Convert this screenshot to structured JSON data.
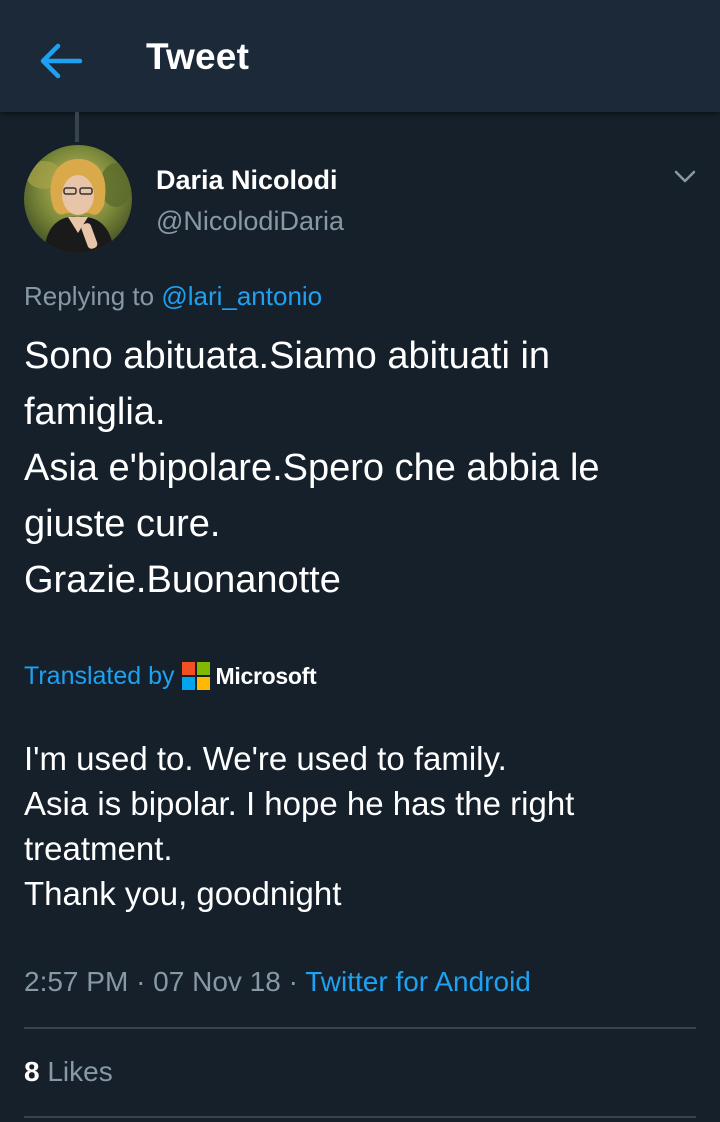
{
  "header": {
    "title": "Tweet",
    "back_icon": "arrow-left-icon"
  },
  "author": {
    "name": "Daria Nicolodi",
    "handle": "@NicolodiDaria",
    "avatar_icon": "profile-photo"
  },
  "reply": {
    "prefix": "Replying to",
    "mention": "@lari_antonio"
  },
  "tweet": {
    "lines": [
      "Sono abituata.Siamo abituati in",
      "famiglia.",
      "Asia e'bipolare.Spero che abbia le",
      "giuste cure.",
      "Grazie.Buonanotte"
    ]
  },
  "translation": {
    "label": "Translated by",
    "provider": "Microsoft",
    "lines": [
      "I'm used to. We're used to family.",
      "Asia is bipolar. I hope he has the right",
      "treatment.",
      "Thank you, goodnight"
    ]
  },
  "meta": {
    "time": "2:57 PM",
    "separator": "·",
    "date": "07 Nov 18",
    "source": "Twitter for Android"
  },
  "stats": {
    "likes_count": "8",
    "likes_label": "Likes"
  },
  "colors": {
    "background": "#15202b",
    "header_bg": "#1c2938",
    "accent": "#1da1f2",
    "secondary_text": "#8899a6",
    "divider": "#38444d"
  }
}
